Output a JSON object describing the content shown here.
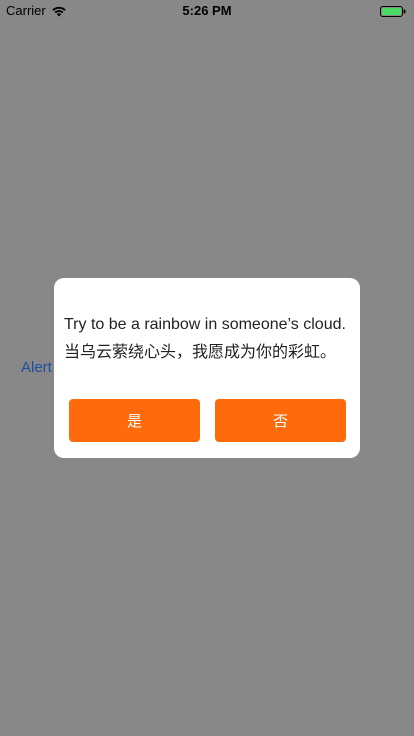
{
  "status_bar": {
    "carrier": "Carrier",
    "time": "5:26 PM",
    "wifi_icon": "wifi-icon",
    "battery_icon": "battery-icon",
    "battery_color": "#4cd964"
  },
  "background": {
    "link_text": "Alert",
    "link_color": "#1f4fa3",
    "overlay_color": "#888888"
  },
  "dialog": {
    "message_line_1": "Try to be a rainbow in someone’s cloud.",
    "message_line_2": "当乌云萦绕心头，我愿成为你的彩虹。",
    "yes_label": "是",
    "no_label": "否",
    "button_color": "#ff6a0d"
  }
}
